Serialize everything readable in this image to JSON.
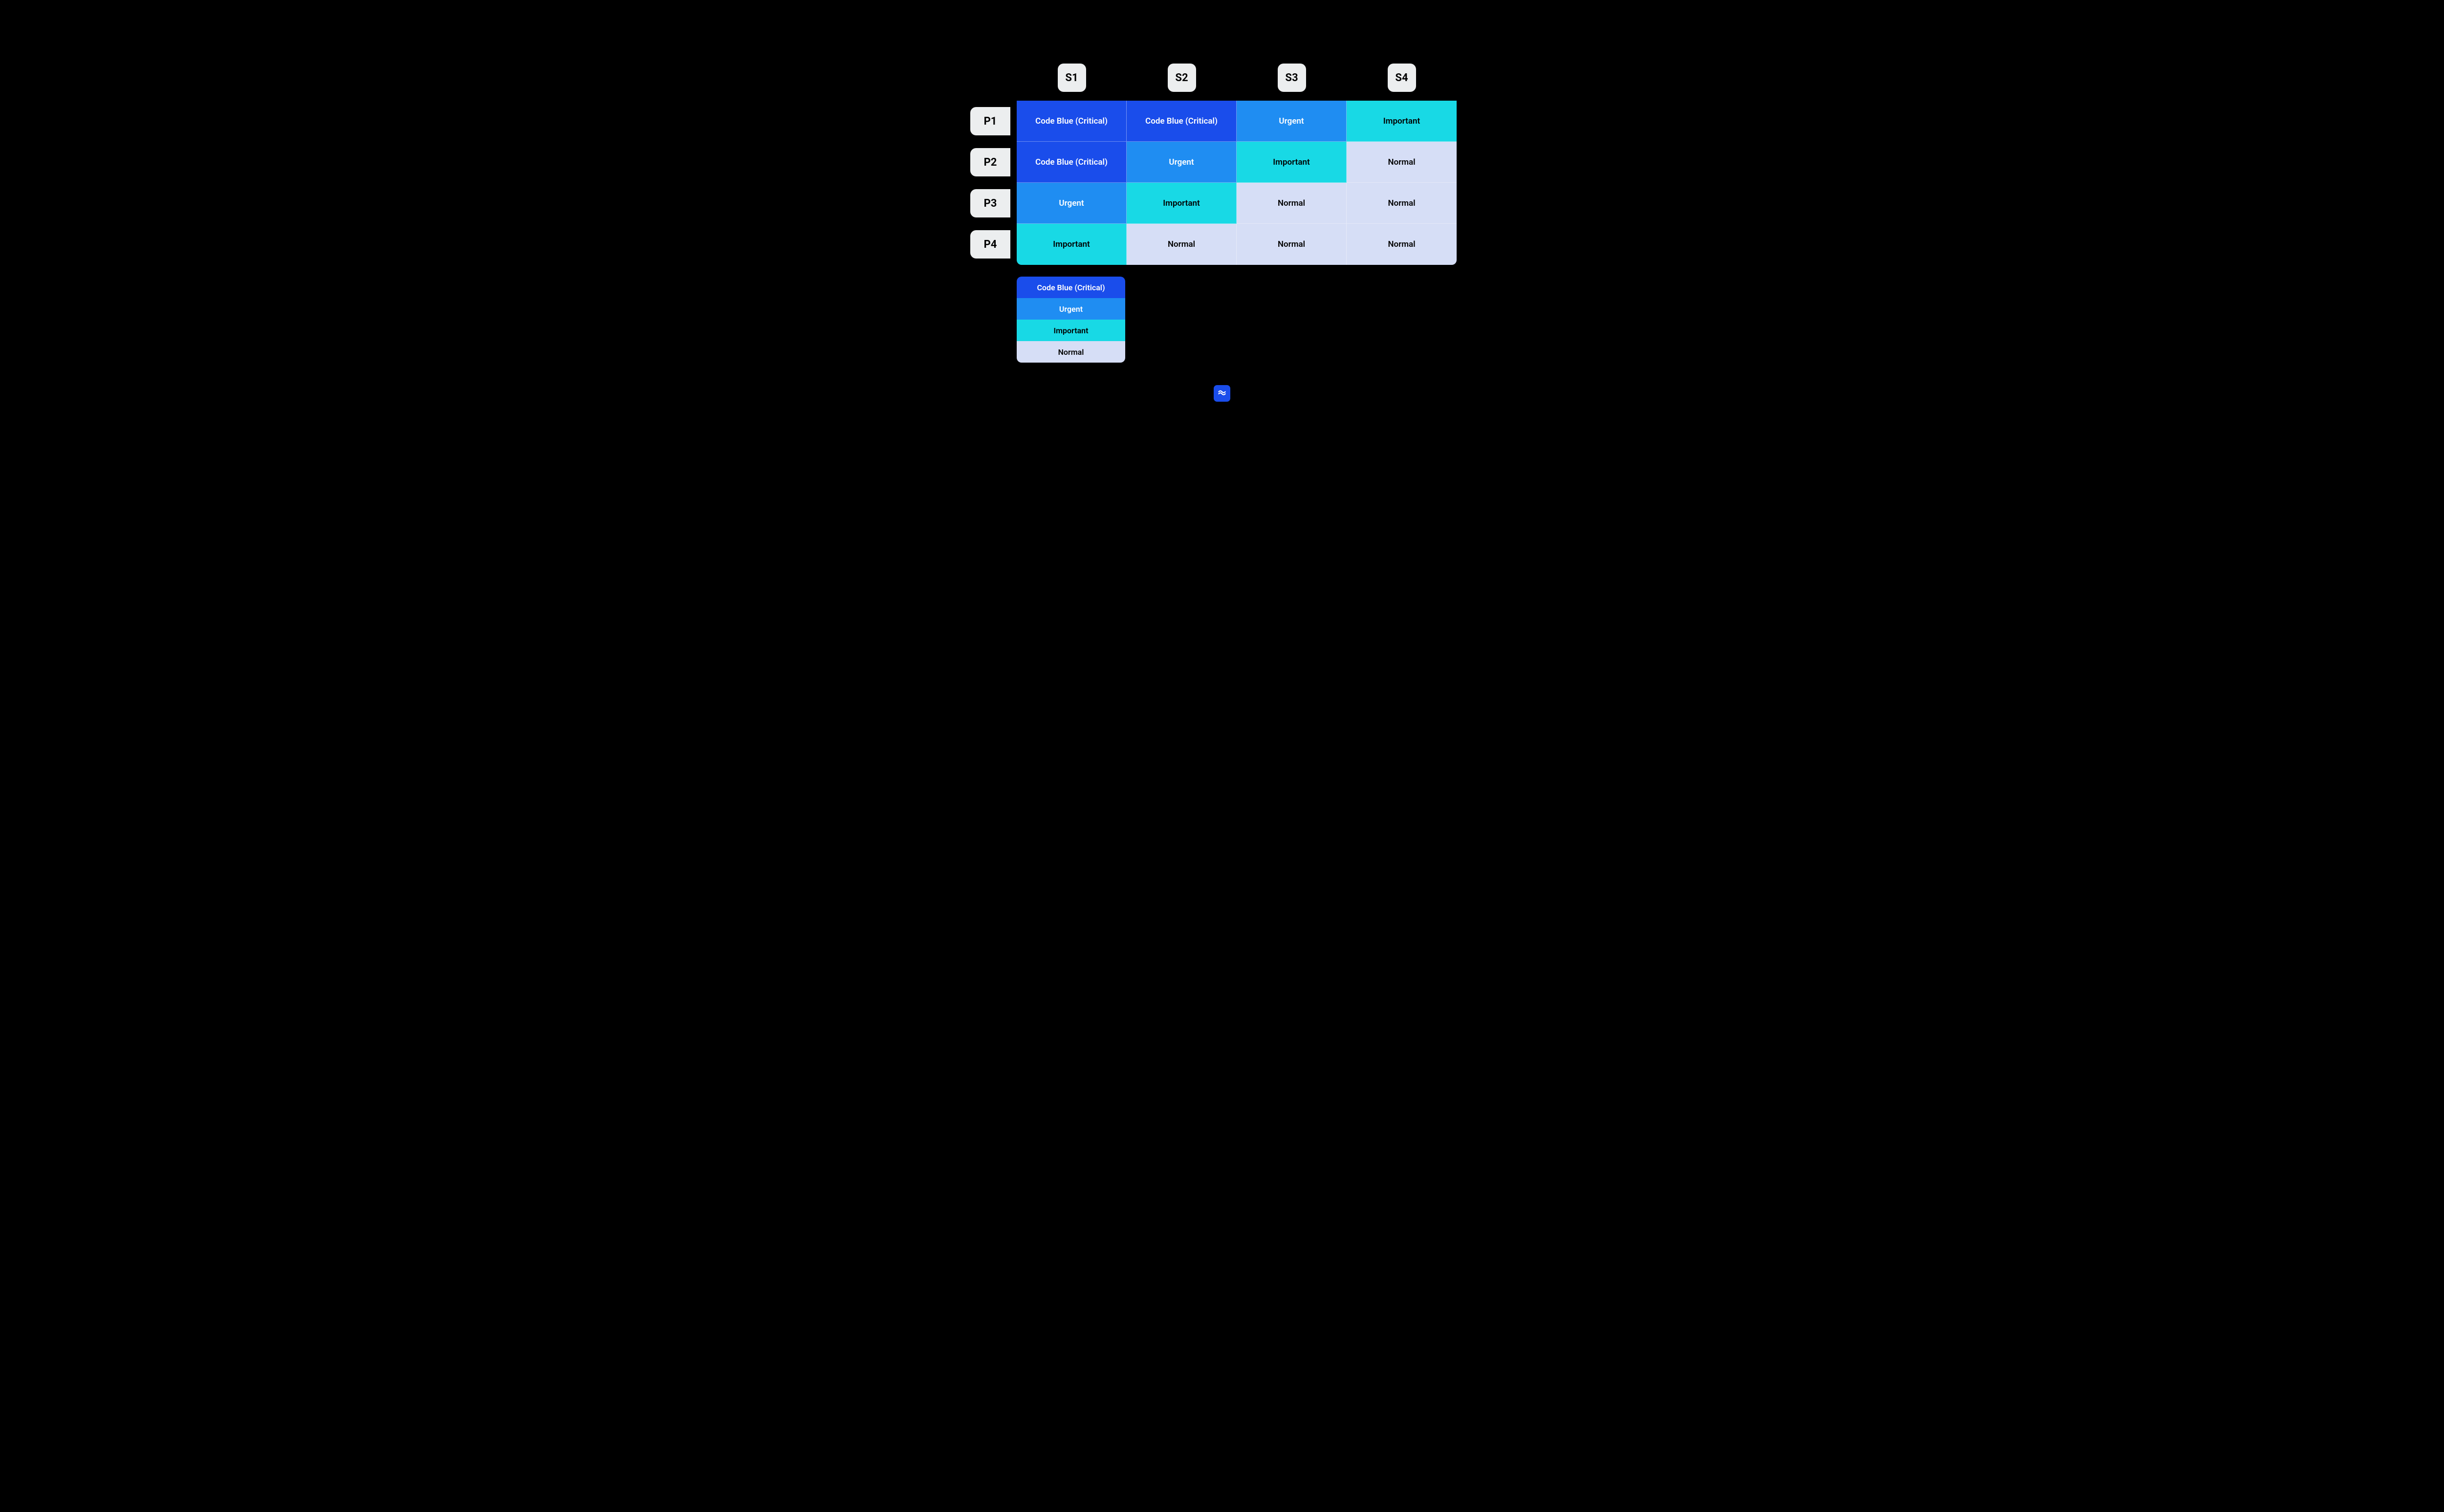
{
  "chart_data": {
    "type": "table",
    "title": "",
    "columns": [
      "S1",
      "S2",
      "S3",
      "S4"
    ],
    "rows": [
      "P1",
      "P2",
      "P3",
      "P4"
    ],
    "cells": [
      [
        "Code Blue (Critical)",
        "Code Blue (Critical)",
        "Urgent",
        "Important"
      ],
      [
        "Code Blue (Critical)",
        "Urgent",
        "Important",
        "Normal"
      ],
      [
        "Urgent",
        "Important",
        "Normal",
        "Normal"
      ],
      [
        "Important",
        "Normal",
        "Normal",
        "Normal"
      ]
    ],
    "levels": [
      {
        "name": "Code Blue (Critical)",
        "color": "#1a4deb",
        "text": "#ffffff"
      },
      {
        "name": "Urgent",
        "color": "#1f8df2",
        "text": "#ffffff"
      },
      {
        "name": "Important",
        "color": "#18d9e5",
        "text": "#000000"
      },
      {
        "name": "Normal",
        "color": "#d6def6",
        "text": "#000000"
      }
    ]
  },
  "columns": {
    "0": "S1",
    "1": "S2",
    "2": "S3",
    "3": "S4"
  },
  "rows": {
    "0": "P1",
    "1": "P2",
    "2": "P3",
    "3": "P4"
  },
  "cells": {
    "0": {
      "0": "Code Blue (Critical)",
      "1": "Code Blue (Critical)",
      "2": "Urgent",
      "3": "Important"
    },
    "1": {
      "0": "Code Blue (Critical)",
      "1": "Urgent",
      "2": "Important",
      "3": "Normal"
    },
    "2": {
      "0": "Urgent",
      "1": "Important",
      "2": "Normal",
      "3": "Normal"
    },
    "3": {
      "0": "Important",
      "1": "Normal",
      "2": "Normal",
      "3": "Normal"
    }
  },
  "legend": {
    "0": "Code Blue (Critical)",
    "1": "Urgent",
    "2": "Important",
    "3": "Normal"
  },
  "footer_icon": "brand-mark-icon"
}
